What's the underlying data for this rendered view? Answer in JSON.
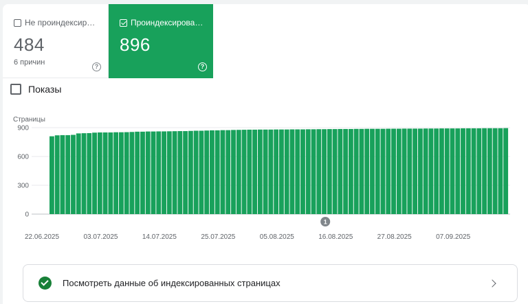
{
  "tabs": [
    {
      "label": "Не проиндексир…",
      "value": "484",
      "sub": "6 причин",
      "checked": false
    },
    {
      "label": "Проиндексирова…",
      "value": "896",
      "checked": true
    }
  ],
  "help_glyph": "?",
  "impressions_toggle": {
    "label": "Показы",
    "checked": false
  },
  "chart_data": {
    "type": "bar",
    "ylabel": "Страницы",
    "ylim": [
      0,
      900
    ],
    "yticks": [
      "900",
      "600",
      "300",
      "0"
    ],
    "ytick_values": [
      900,
      600,
      300,
      0
    ],
    "xticks": [
      "22.06.2025",
      "03.07.2025",
      "14.07.2025",
      "25.07.2025",
      "05.08.2025",
      "16.08.2025",
      "27.08.2025",
      "07.09.2025"
    ],
    "xtick_indices": [
      0,
      11,
      22,
      33,
      44,
      55,
      66,
      77
    ],
    "annotation": {
      "label": "1",
      "index": 55
    },
    "bar_color": "#18a15b",
    "values": [
      810,
      820,
      822,
      822,
      825,
      840,
      842,
      843,
      848,
      850,
      850,
      850,
      852,
      852,
      853,
      855,
      858,
      858,
      860,
      860,
      861,
      861,
      862,
      863,
      864,
      864,
      866,
      868,
      868,
      870,
      872,
      872,
      874,
      874,
      876,
      877,
      878,
      879,
      879,
      880,
      880,
      880,
      881,
      881,
      881,
      882,
      882,
      882,
      883,
      883,
      884,
      884,
      885,
      885,
      886,
      886,
      886,
      887,
      887,
      888,
      888,
      888,
      888,
      889,
      889,
      889,
      890,
      890,
      890,
      890,
      891,
      891,
      891,
      892,
      892,
      892,
      892,
      893,
      893,
      893,
      893,
      894,
      894,
      894,
      894,
      895
    ]
  },
  "action": {
    "label": "Посмотреть данные об индексированных страницах"
  },
  "colors": {
    "accent": "#18a15b",
    "ok": "#188038"
  }
}
